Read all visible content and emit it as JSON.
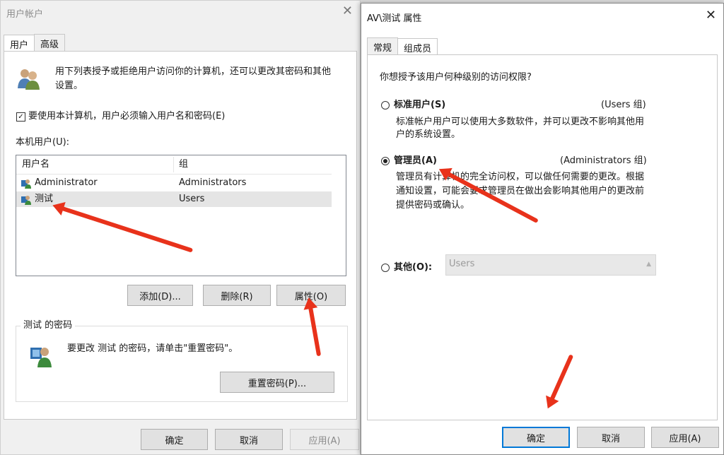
{
  "left_window": {
    "title": "用户帐户",
    "tabs": [
      "用户",
      "高级"
    ],
    "intro": [
      "用下列表授予或拒绝用户访问你的计算机，还可以更改其密码和其他",
      "设置。"
    ],
    "checkbox_label": "要使用本计算机，用户必须输入用户名和密码(E)",
    "local_users_label": "本机用户(U):",
    "columns": [
      "用户名",
      "组"
    ],
    "rows": [
      {
        "name": "Administrator",
        "group": "Administrators"
      },
      {
        "name": "测试",
        "group": "Users"
      }
    ],
    "buttons": {
      "add": "添加(D)...",
      "remove": "删除(R)",
      "properties": "属性(O)"
    },
    "password_group_title": "测试 的密码",
    "password_text": "要更改 测试 的密码，请单击\"重置密码\"。",
    "reset_button": "重置密码(P)...",
    "footer": {
      "ok": "确定",
      "cancel": "取消",
      "apply": "应用(A)"
    }
  },
  "right_window": {
    "title": "AV\\测试 属性",
    "tabs": [
      "常规",
      "组成员"
    ],
    "question": "你想授予该用户何种级别的访问权限?",
    "options": {
      "standard": {
        "label": "标准用户(S)",
        "group": "(Users 组)",
        "desc": [
          "标准帐户用户可以使用大多数软件，并可以更改不影响其他用",
          "户的系统设置。"
        ]
      },
      "admin": {
        "label": "管理员(A)",
        "group": "(Administrators 组)",
        "desc": [
          "管理员有计算机的完全访问权，可以做任何需要的更改。根据",
          "通知设置，可能会要求管理员在做出会影响其他用户的更改前",
          "提供密码或确认。"
        ]
      },
      "other": {
        "label": "其他(O):",
        "select_value": "Users"
      }
    },
    "footer": {
      "ok": "确定",
      "cancel": "取消",
      "apply": "应用(A)"
    }
  },
  "colors": {
    "arrow": "#e8321b",
    "focus": "#0078d7"
  }
}
